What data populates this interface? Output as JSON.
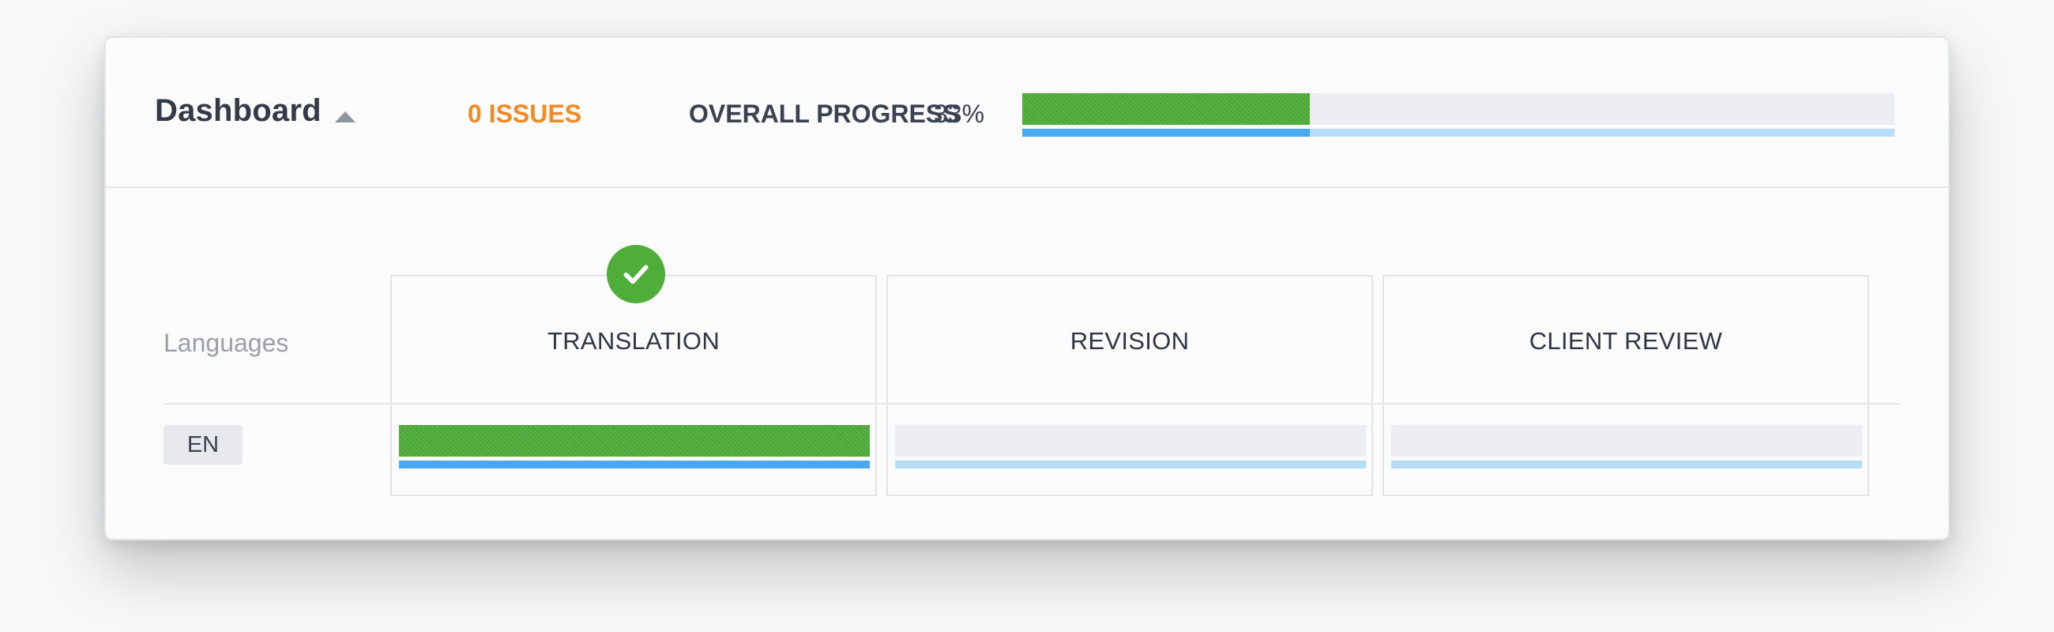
{
  "header": {
    "title": "Dashboard",
    "issues_label": "0 ISSUES",
    "overall_label": "OVERALL PROGRESS",
    "overall_percent": "33%",
    "overall_progress": 0.33
  },
  "table": {
    "languages_label": "Languages",
    "stages": [
      {
        "label": "TRANSLATION",
        "progress": 1.0,
        "completed": true
      },
      {
        "label": "REVISION",
        "progress": 0.0,
        "completed": false
      },
      {
        "label": "CLIENT REVIEW",
        "progress": 0.0,
        "completed": false
      }
    ],
    "languages": [
      {
        "code": "EN"
      }
    ]
  },
  "icons": {
    "collapse": "caret-up-icon",
    "completed": "check-circle-icon"
  },
  "colors": {
    "issues": "#f08a24",
    "progress_green": "#4fae3a",
    "progress_blue": "#47a9f0",
    "track_light_blue": "#b7dcf7",
    "track_gray": "#eceef1"
  }
}
